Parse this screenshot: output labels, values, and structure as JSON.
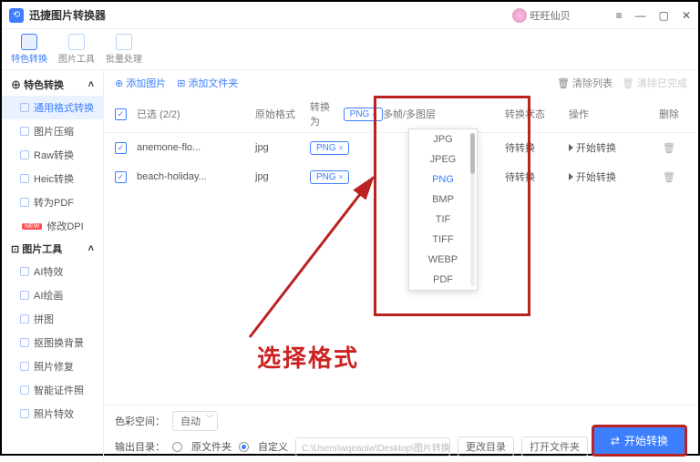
{
  "titlebar": {
    "appName": "迅捷图片转换器",
    "userName": "旺旺仙贝"
  },
  "topnav": {
    "t0": "特色转换",
    "t1": "图片工具",
    "t2": "批量处理"
  },
  "sidebar": {
    "g1": "特色转换",
    "s1": "通用格式转换",
    "s2": "图片压缩",
    "s3": "Raw转换",
    "s4": "Heic转换",
    "s5": "转为PDF",
    "s6": "修改DPI",
    "g2": "图片工具",
    "s7": "AI特效",
    "s8": "AI绘画",
    "s9": "拼图",
    "s10": "抠图换背景",
    "s11": "照片修复",
    "s12": "智能证件照",
    "s13": "照片特效"
  },
  "toolbar": {
    "addImg": "添加图片",
    "addFolder": "添加文件夹",
    "clearList": "清除列表",
    "clearDone": "清除已完成"
  },
  "table": {
    "selected": "已选 (2/2)",
    "hOrig": "原始格式",
    "hConv": "转换为",
    "hConvVal": "PNG",
    "hMulti": "多帧/多图层",
    "hStatus": "转换状态",
    "hOp": "操作",
    "hDel": "删除",
    "rows": [
      {
        "name": "anemone-flo...",
        "orig": "jpg",
        "fmt": "PNG",
        "status": "待转换",
        "op": "开始转换"
      },
      {
        "name": "beach-holiday...",
        "orig": "jpg",
        "fmt": "PNG",
        "status": "待转换",
        "op": "开始转换"
      }
    ]
  },
  "dropdown": {
    "o0": "JPG",
    "o1": "JPEG",
    "o2": "PNG",
    "o3": "BMP",
    "o4": "TIF",
    "o5": "TIFF",
    "o6": "WEBP",
    "o7": "PDF"
  },
  "annotation": "选择格式",
  "footer": {
    "colorSpace": "色彩空间：",
    "colorVal": "自动",
    "outDir": "输出目录：",
    "r1": "原文件夹",
    "r2": "自定义",
    "path": "C:\\Users\\wqeaoiw\\Desktop\\图片转换",
    "changeDir": "更改目录",
    "openDir": "打开文件夹",
    "start": "开始转换"
  }
}
